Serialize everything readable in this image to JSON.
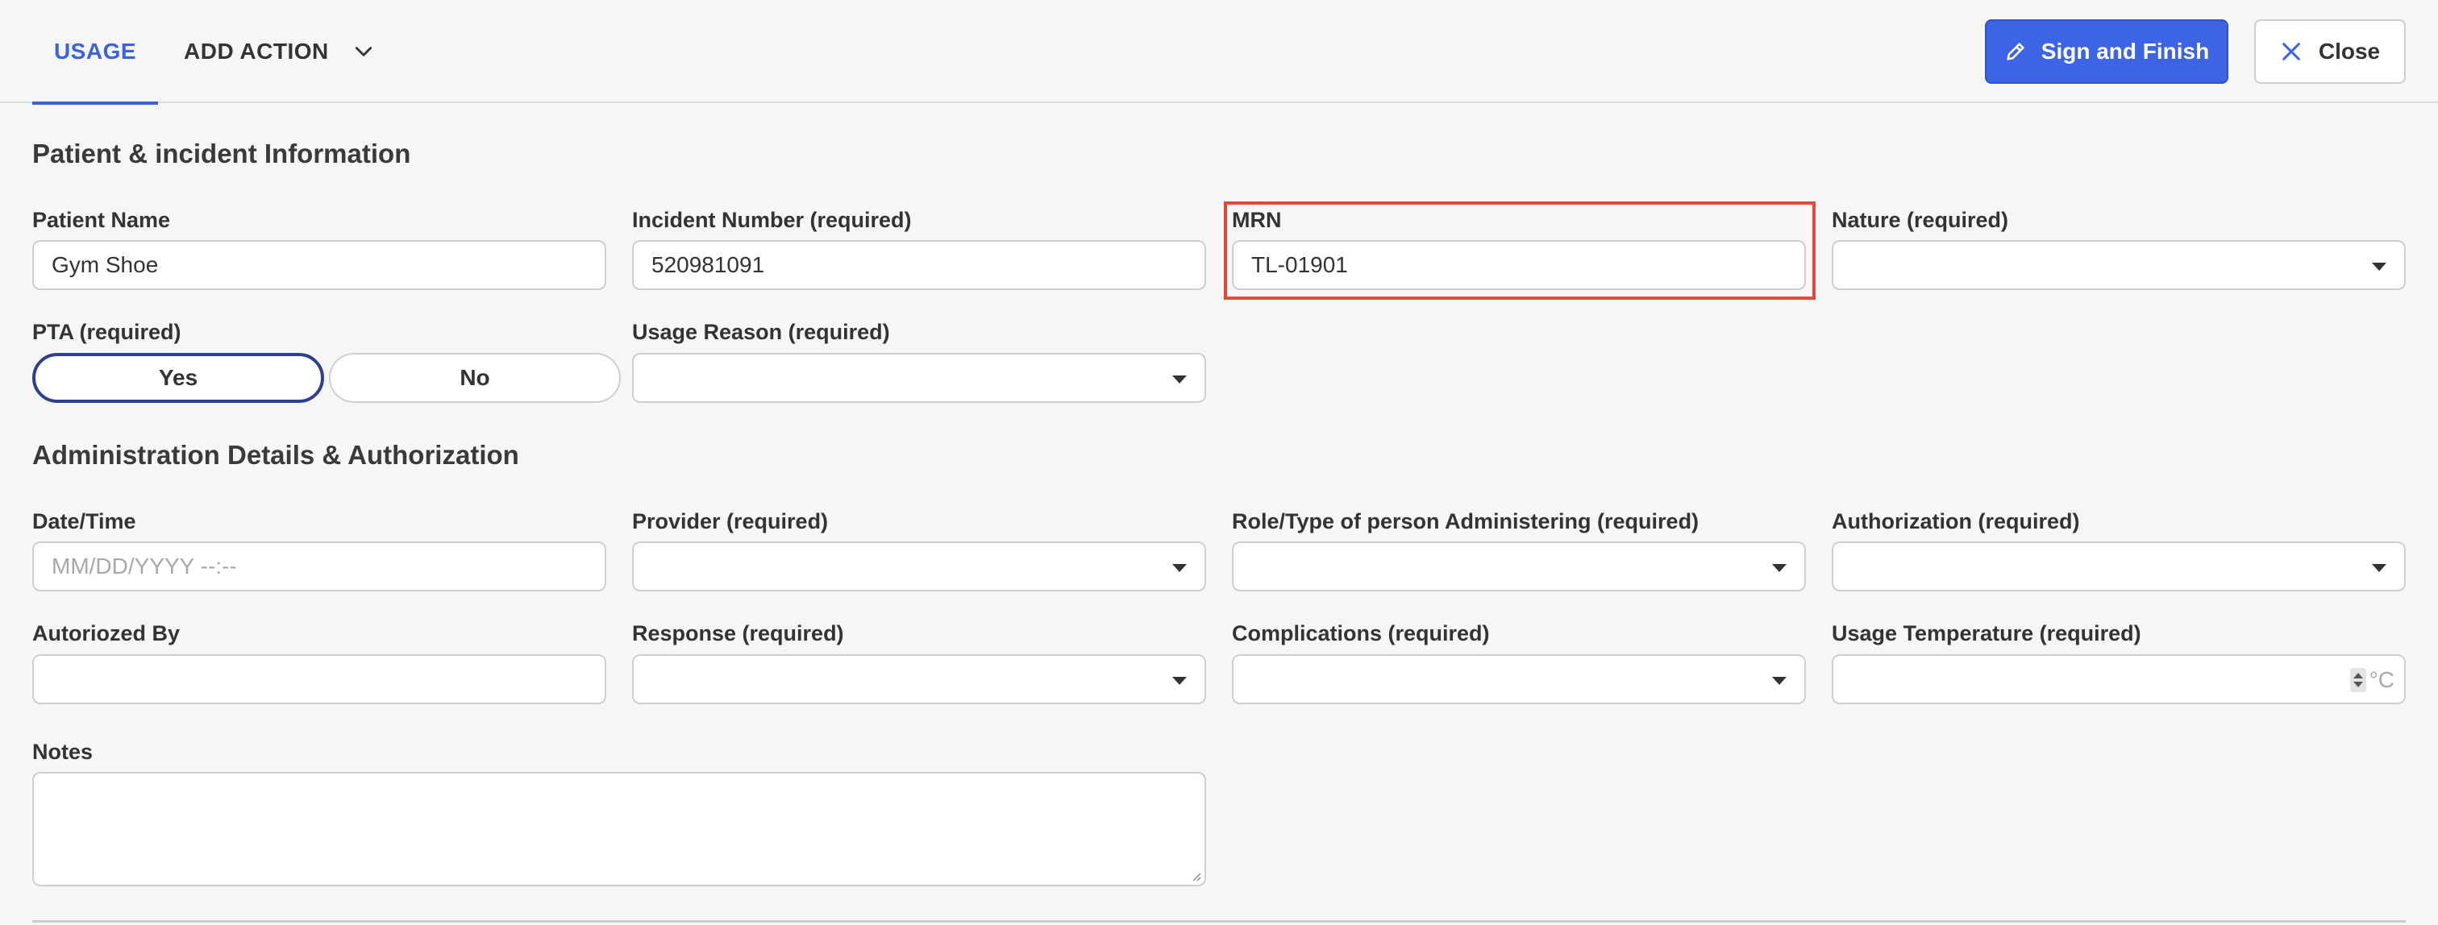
{
  "tabs": {
    "usage": "USAGE",
    "add_action": "ADD ACTION"
  },
  "actions": {
    "sign_and_finish": "Sign and Finish",
    "close": "Close"
  },
  "colors": {
    "primary": "#3c64e4",
    "tab_active": "#3b63e0",
    "highlight": "#e04a3a",
    "pill_selected": "#2e3f8f"
  },
  "patient_section": {
    "title": "Patient & incident Information",
    "patient_name": {
      "label": "Patient Name",
      "value": "Gym Shoe"
    },
    "incident_number": {
      "label": "Incident Number (required)",
      "value": "520981091"
    },
    "mrn": {
      "label": "MRN",
      "value": "TL-01901"
    },
    "nature": {
      "label": "Nature (required)",
      "value": ""
    },
    "pta": {
      "label": "PTA (required)",
      "yes": "Yes",
      "no": "No",
      "selected": "Yes"
    },
    "usage_reason": {
      "label": "Usage Reason (required)",
      "value": ""
    }
  },
  "admin_section": {
    "title": "Administration Details & Authorization",
    "date_time": {
      "label": "Date/Time",
      "placeholder": "MM/DD/YYYY --:--"
    },
    "provider": {
      "label": "Provider (required)",
      "value": ""
    },
    "role_type": {
      "label": "Role/Type of person Administering (required)",
      "value": ""
    },
    "authorization": {
      "label": "Authorization (required)",
      "value": ""
    },
    "authorized_by": {
      "label": "Autoriozed By",
      "value": ""
    },
    "response": {
      "label": "Response (required)",
      "value": ""
    },
    "complications": {
      "label": "Complications (required)",
      "value": ""
    },
    "usage_temperature": {
      "label": "Usage Temperature (required)",
      "value": "",
      "unit": "°C"
    },
    "notes": {
      "label": "Notes",
      "value": ""
    }
  },
  "icons": {
    "chevron": "chevron-down-icon",
    "sign": "pen-icon",
    "close": "close-icon"
  }
}
